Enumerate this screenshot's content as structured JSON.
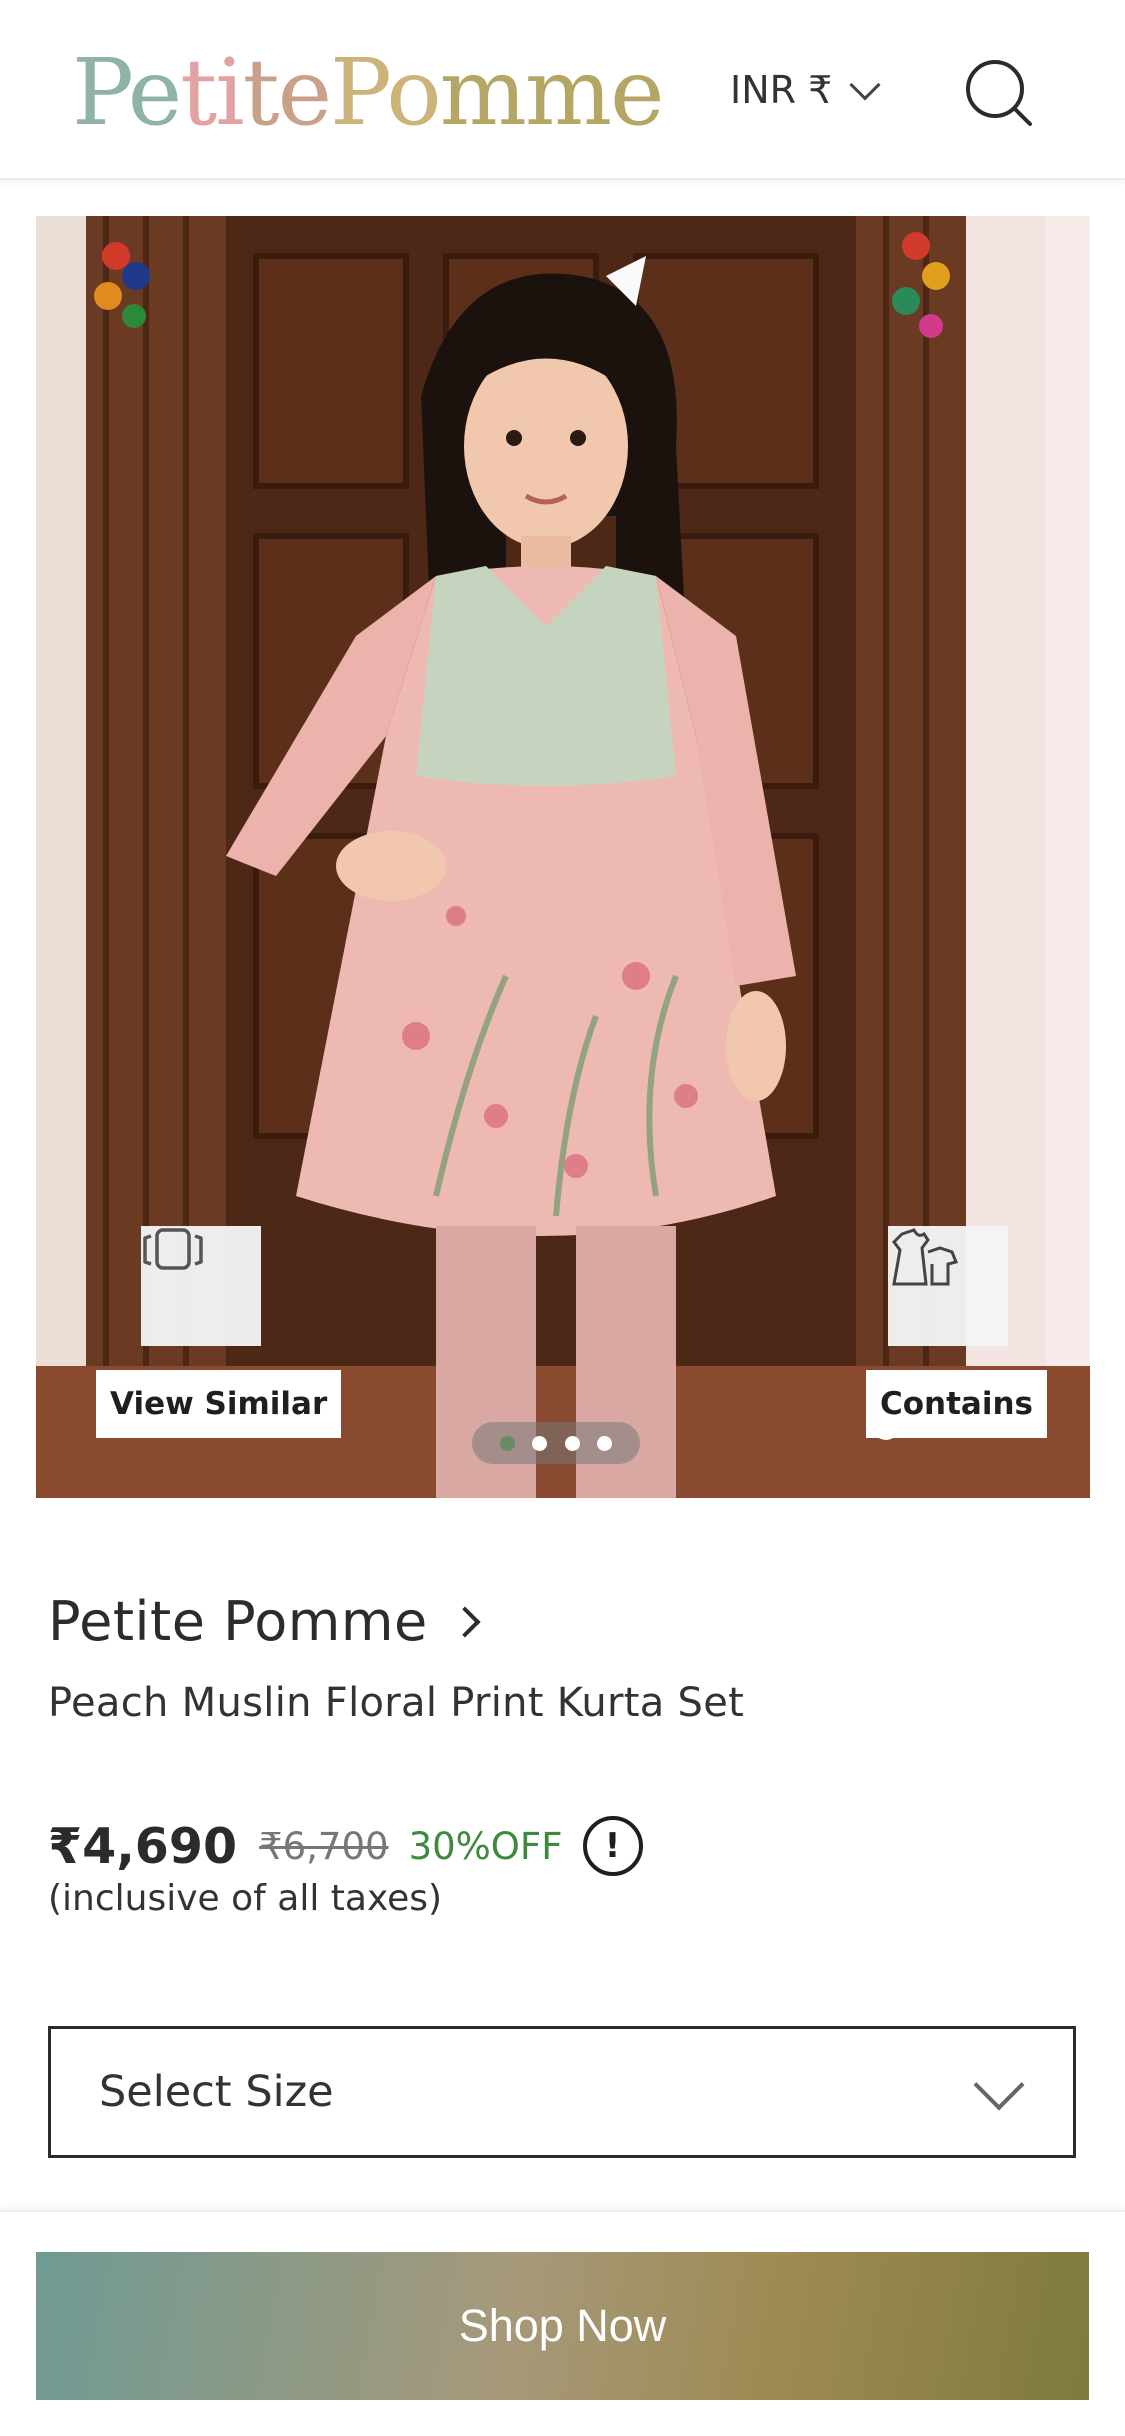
{
  "header": {
    "logo_parts": [
      "Pe",
      "ti",
      "te",
      "Po",
      "mme"
    ],
    "currency_label": "INR ₹"
  },
  "gallery": {
    "view_similar_label": "View Similar",
    "contains_label": "Contains",
    "image_count": 4,
    "active_index": 0
  },
  "product": {
    "brand": "Petite Pomme",
    "name": "Peach Muslin Floral Print Kurta Set",
    "price": "₹4,690",
    "mrp": "₹6,700",
    "discount": "30%OFF",
    "info_icon_glyph": "!",
    "tax_note": "(inclusive of all taxes)"
  },
  "size": {
    "placeholder": "Select Size"
  },
  "cta": {
    "label": "Shop Now"
  },
  "colors": {
    "discount_green": "#3d8a3d",
    "cta_gradient_start": "#6f9a94",
    "cta_gradient_end": "#7e7a3f"
  }
}
